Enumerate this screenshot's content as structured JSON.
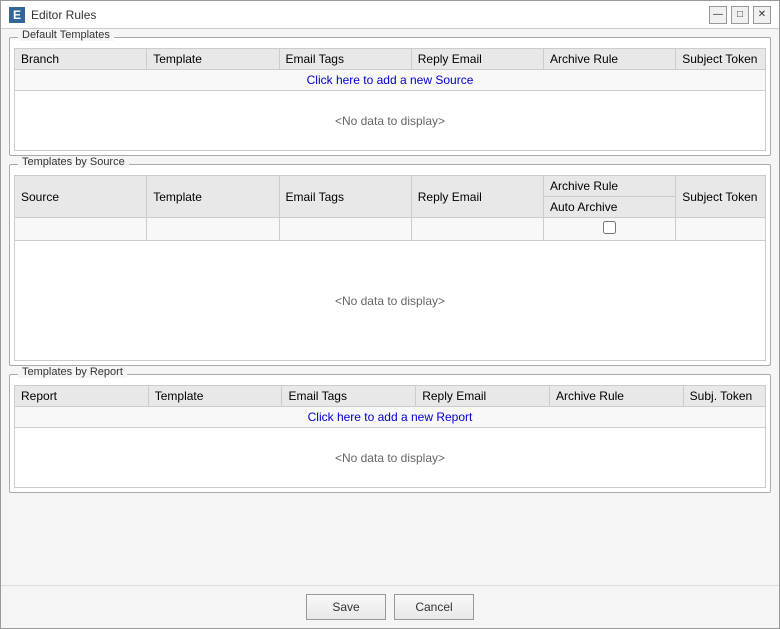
{
  "window": {
    "title": "Editor Rules",
    "icon": "E",
    "controls": {
      "minimize": "—",
      "restore": "□",
      "close": "✕"
    }
  },
  "sections": {
    "default_templates": {
      "title": "Default Templates",
      "columns": [
        "Branch",
        "Template",
        "Email Tags",
        "Reply Email",
        "Archive Rule",
        "Subject Token"
      ],
      "add_row_text": "Click here to add a new Source",
      "no_data_text": "<No data to display>"
    },
    "templates_by_source": {
      "title": "Templates by Source",
      "columns": [
        "Source",
        "Template",
        "Email Tags",
        "Reply Email",
        "Archive Rule",
        "Subject Token"
      ],
      "sub_columns": {
        "archive_rule": "Auto Archive"
      },
      "no_data_text": "<No data to display>"
    },
    "templates_by_report": {
      "title": "Templates by Report",
      "columns": [
        "Report",
        "Template",
        "Email Tags",
        "Reply Email",
        "Archive Rule",
        "Subj. Token"
      ],
      "add_row_text": "Click here to add a new Report",
      "no_data_text": "<No data to display>"
    }
  },
  "footer": {
    "save_label": "Save",
    "cancel_label": "Cancel"
  }
}
